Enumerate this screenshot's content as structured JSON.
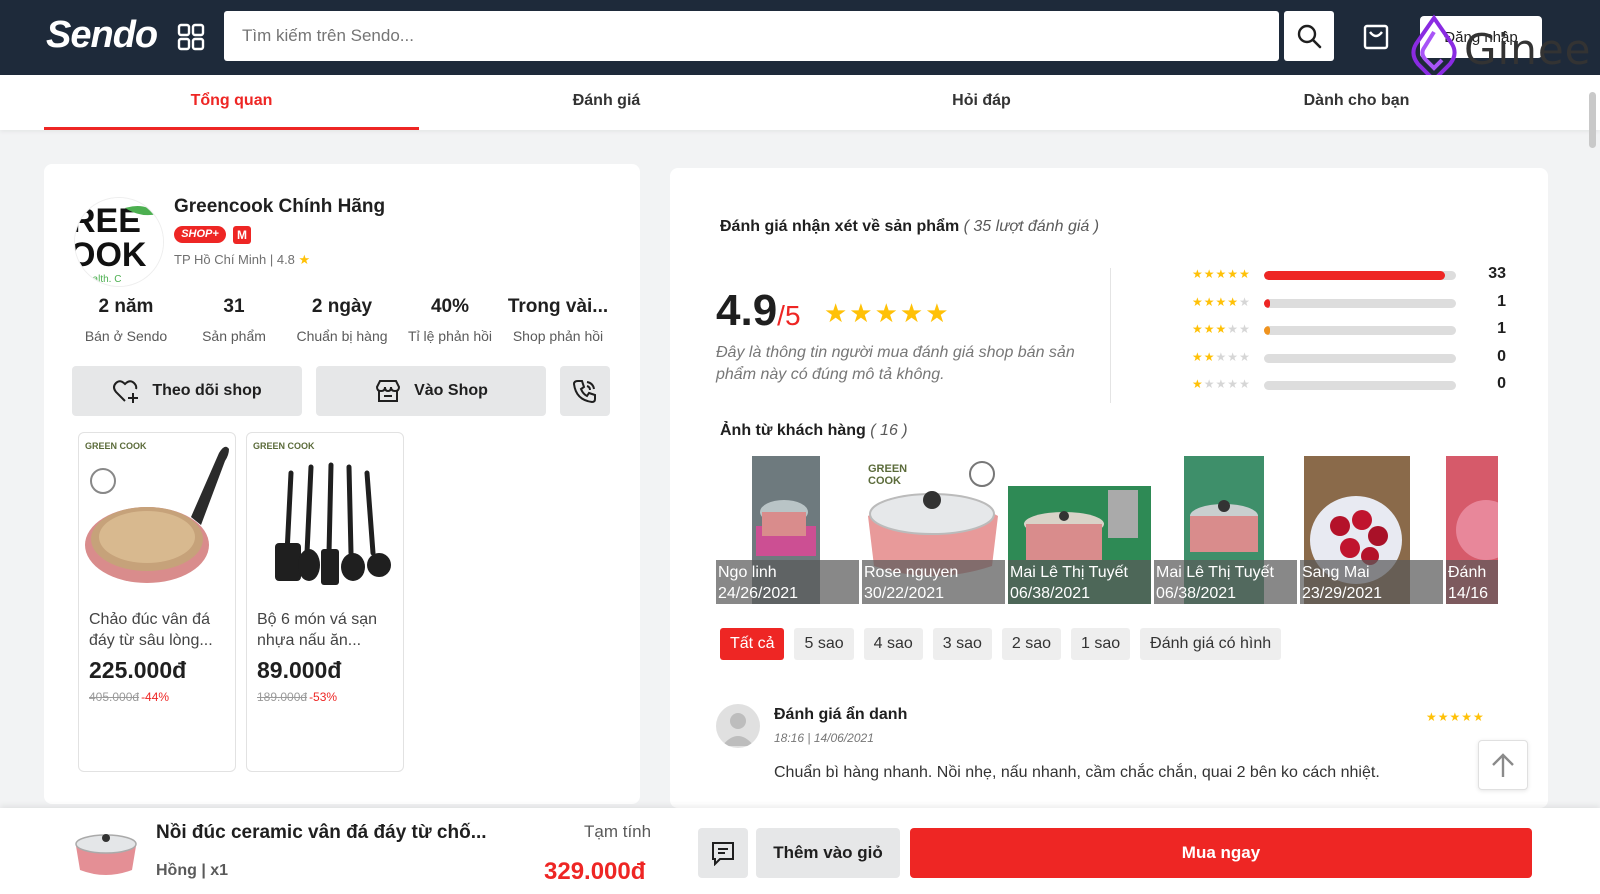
{
  "header": {
    "logo": "Sendo",
    "search_placeholder": "Tìm kiếm trên Sendo...",
    "login_label": "Đăng nhập",
    "watermark": "Ginee",
    "colors": {
      "bg": "#1e2a3a",
      "accent": "#ee2624"
    }
  },
  "tabs": [
    {
      "label": "Tổng quan",
      "active": true
    },
    {
      "label": "Đánh giá",
      "active": false
    },
    {
      "label": "Hỏi đáp",
      "active": false
    },
    {
      "label": "Dành cho bạn",
      "active": false
    }
  ],
  "shop": {
    "name": "Greencook Chính Hãng",
    "badge": "SHOP+",
    "mall_badge": "M",
    "location_rating": "TP Hồ Chí Minh | 4.8",
    "stats": [
      {
        "value": "2 năm",
        "label": "Bán ở Sendo"
      },
      {
        "value": "31",
        "label": "Sản phẩm"
      },
      {
        "value": "2 ngày",
        "label": "Chuẩn bị hàng"
      },
      {
        "value": "40%",
        "label": "Tỉ lệ phản hồi"
      },
      {
        "value": "Trong vài...",
        "label": "Shop phản hồi"
      }
    ],
    "follow_label": "Theo dõi shop",
    "visit_label": "Vào Shop",
    "products": [
      {
        "brand": "GREEN COOK",
        "title": "Chảo đúc vân đá đáy từ sâu lòng...",
        "price": "225.000đ",
        "old_price": "405.000đ",
        "discount": "-44%"
      },
      {
        "brand": "GREEN COOK",
        "title": "Bộ 6 món vá sạn nhựa nấu ăn...",
        "price": "89.000đ",
        "old_price": "189.000đ",
        "discount": "-53%"
      }
    ]
  },
  "reviews": {
    "title": "Đánh giá nhận xét về sản phẩm",
    "count_text": "( 35 lượt đánh giá )",
    "score": "4.9",
    "score_max": "/5",
    "score_stars": "★★★★★",
    "description": "Đây là thông tin người mua đánh giá shop bán sản phẩm này có đúng mô tả không.",
    "distribution": [
      {
        "stars": 5,
        "count": "33",
        "fraction": 0.943,
        "color": "#ee2624"
      },
      {
        "stars": 4,
        "count": "1",
        "fraction": 0.03,
        "color": "#ee2624"
      },
      {
        "stars": 3,
        "count": "1",
        "fraction": 0.03,
        "color": "#f0931e"
      },
      {
        "stars": 2,
        "count": "0",
        "fraction": 0,
        "color": "#ee2624"
      },
      {
        "stars": 1,
        "count": "0",
        "fraction": 0,
        "color": "#ee2624"
      }
    ],
    "photos_title": "Ảnh từ khách hàng",
    "photos_count": "( 16 )",
    "photos": [
      {
        "name": "Ngo linh",
        "date": "24/26/2021"
      },
      {
        "name": "Rose nguyen",
        "date": "30/22/2021"
      },
      {
        "name": "Mai Lê Thị Tuyết",
        "date": "06/38/2021"
      },
      {
        "name": "Mai Lê Thị Tuyết",
        "date": "06/38/2021"
      },
      {
        "name": "Sang Mai",
        "date": "23/29/2021"
      },
      {
        "name": "Đánh",
        "date": "14/16"
      }
    ],
    "filters": [
      {
        "label": "Tất cả",
        "active": true
      },
      {
        "label": "5 sao",
        "active": false
      },
      {
        "label": "4 sao",
        "active": false
      },
      {
        "label": "3 sao",
        "active": false
      },
      {
        "label": "2 sao",
        "active": false
      },
      {
        "label": "1 sao",
        "active": false
      },
      {
        "label": "Đánh giá có hình",
        "active": false
      }
    ],
    "first_review": {
      "name": "Đánh giá ẩn danh",
      "time": "18:16 | 14/06/2021",
      "stars": "★★★★★",
      "text": "Chuẩn bì hàng nhanh. Nồi nhẹ, nấu nhanh, cầm chắc chắn, quai 2 bên ko cách nhiệt."
    }
  },
  "bottom_bar": {
    "product_name": "Nồi đúc ceramic vân đá đáy từ chố...",
    "variant": "Hồng | x1",
    "subtotal_label": "Tạm tính",
    "subtotal": "329.000đ",
    "add_cart_label": "Thêm vào giỏ",
    "buy_label": "Mua ngay"
  }
}
